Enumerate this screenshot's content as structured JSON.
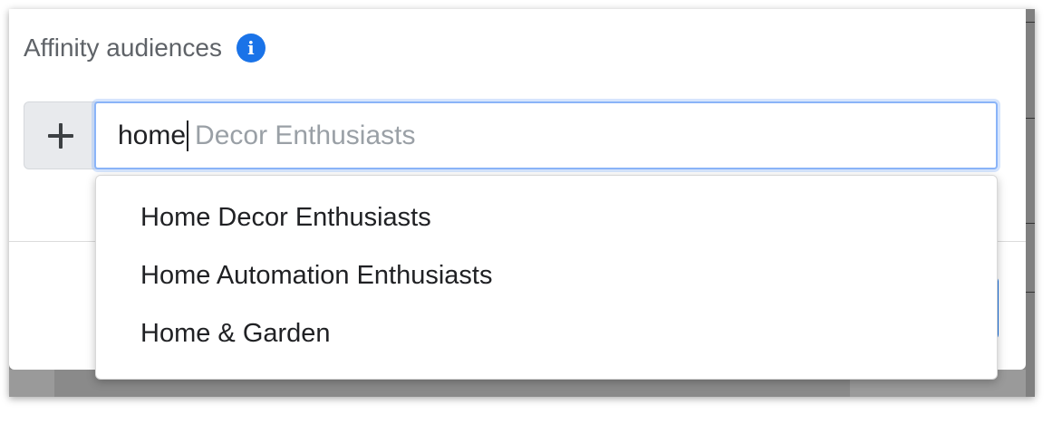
{
  "section": {
    "title": "Affinity audiences",
    "info_icon": "info-circle-icon"
  },
  "search": {
    "typed_value": "home",
    "suggestion_completion": "Decor Enthusiasts",
    "add_icon": "plus-icon"
  },
  "dropdown": {
    "items": [
      {
        "label": "Home Decor Enthusiasts"
      },
      {
        "label": "Home Automation Enthusiasts"
      },
      {
        "label": "Home & Garden"
      }
    ]
  },
  "colors": {
    "accent": "#1a73e8",
    "focus_ring": "#8ab4f8",
    "title_text": "#5f6368",
    "placeholder_text": "#9aa0a6"
  }
}
